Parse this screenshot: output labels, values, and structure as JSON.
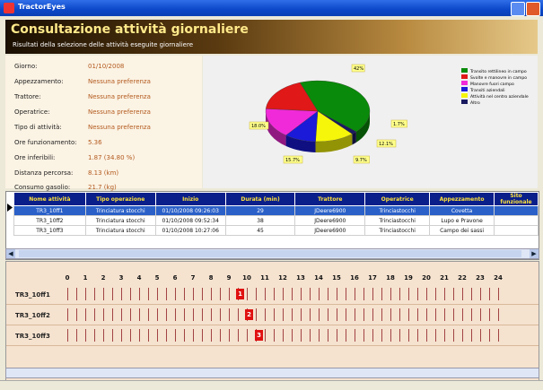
{
  "window": {
    "title": "TractorEyes"
  },
  "banner": {
    "title": "Consultazione attività giornaliere",
    "subtitle": "Risultati della selezione delle attività eseguite giornaliere"
  },
  "info": {
    "labels": [
      "Giorno:",
      "Appezzamento:",
      "Trattore:",
      "Operatrice:",
      "Tipo di attività:",
      "Ore funzionamento:",
      "Ore inferibili:",
      "Distanza percorsa:",
      "Consumo gasolio:"
    ],
    "values": [
      "01/10/2008",
      "Nessuna preferenza",
      "Nessuna preferenza",
      "Nessuna preferenza",
      "Nessuna preferenza",
      "5.36",
      "1.87 (34.80 %)",
      "8.13 (km)",
      "21.7 (kg)"
    ]
  },
  "chart_data": {
    "type": "pie",
    "categories": [
      "Transito rettilineo in campo",
      "Svolte e manovre in campo",
      "Manovre fuori campo",
      "Transiti aziendali",
      "Attività nel centro aziendale",
      "Altro"
    ],
    "values": [
      42,
      18.0,
      15.7,
      9.7,
      12.1,
      1.7
    ],
    "labels": [
      "42%",
      "18.0%",
      "15.7%",
      "9.7%",
      "12.1%",
      "1.7%"
    ],
    "colors": [
      "#0a8a0a",
      "#e01818",
      "#f02ad8",
      "#1a1ad8",
      "#f6f60a",
      "#1a1a60"
    ]
  },
  "table": {
    "headers": [
      "Nome attività",
      "Tipo operazione",
      "Inizio",
      "Durata (min)",
      "Trattore",
      "Operatrice",
      "Appezzamento",
      "Sito funzionale"
    ],
    "rows": [
      [
        "TR3_10ff1",
        "Trinciatura stocchi",
        "01/10/2008 09:26:03",
        "29",
        "JDeere6900",
        "Trinciastocchi",
        "Covetta",
        ""
      ],
      [
        "TR3_10ff2",
        "Trinciatura stocchi",
        "01/10/2008 09:52:34",
        "38",
        "JDeere6900",
        "Trinciastocchi",
        "Lupo e Pravone",
        ""
      ],
      [
        "TR3_10ff3",
        "Trinciatura stocchi",
        "01/10/2008 10:27:06",
        "45",
        "JDeere6900",
        "Trinciastocchi",
        "Campo dei sassi",
        ""
      ]
    ]
  },
  "timeline": {
    "hours": [
      "0",
      "1",
      "2",
      "3",
      "4",
      "5",
      "6",
      "7",
      "8",
      "9",
      "10",
      "11",
      "12",
      "13",
      "14",
      "15",
      "16",
      "17",
      "18",
      "19",
      "20",
      "21",
      "22",
      "23",
      "24"
    ],
    "lanes": [
      {
        "label": "TR3_10ff1",
        "block": "1",
        "start_hour": 9.4
      },
      {
        "label": "TR3_10ff2",
        "block": "2",
        "start_hour": 9.9
      },
      {
        "label": "TR3_10ff3",
        "block": "3",
        "start_hour": 10.45
      }
    ]
  }
}
